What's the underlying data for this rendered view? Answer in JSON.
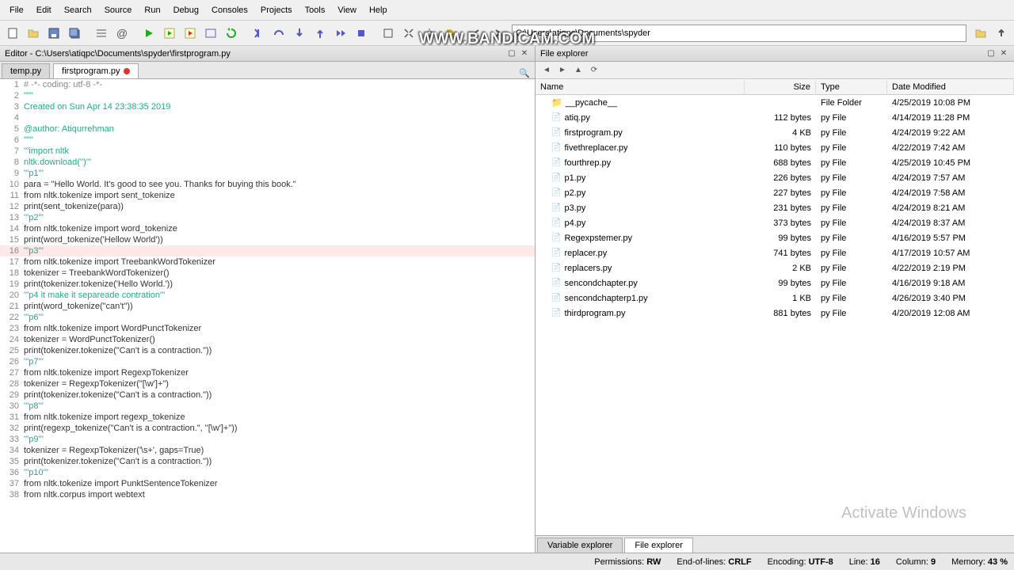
{
  "menubar": [
    "File",
    "Edit",
    "Search",
    "Source",
    "Run",
    "Debug",
    "Consoles",
    "Projects",
    "Tools",
    "View",
    "Help"
  ],
  "path": "C:\\Users\\atiqpc\\Documents\\spyder",
  "editor": {
    "title": "Editor - C:\\Users\\atiqpc\\Documents\\spyder\\firstprogram.py",
    "tabs": [
      {
        "label": "temp.py",
        "active": false,
        "dirty": false
      },
      {
        "label": "firstprogram.py",
        "active": true,
        "dirty": true
      }
    ],
    "highlight_ln": 16,
    "lines": [
      {
        "n": 1,
        "t": "# -*- coding: utf-8 -*-",
        "cls": "c-cm"
      },
      {
        "n": 2,
        "t": "\"\"\"",
        "cls": "c-str"
      },
      {
        "n": 3,
        "t": "Created on Sun Apr 14 23:38:35 2019",
        "cls": "c-str"
      },
      {
        "n": 4,
        "t": "",
        "cls": ""
      },
      {
        "n": 5,
        "t": "@author: Atiqurrehman",
        "cls": "c-str"
      },
      {
        "n": 6,
        "t": "\"\"\"",
        "cls": "c-str"
      },
      {
        "n": 7,
        "t": "'''import nltk",
        "cls": "c-str"
      },
      {
        "n": 8,
        "t": "nltk.download('')'''",
        "cls": "c-str"
      },
      {
        "n": 9,
        "t": "'''p1'''",
        "cls": "c-str"
      },
      {
        "n": 10,
        "t": "para = \"Hello World. It's good to see you. Thanks for buying this book.\"",
        "cls": ""
      },
      {
        "n": 11,
        "t": "from nltk.tokenize import sent_tokenize",
        "cls": ""
      },
      {
        "n": 12,
        "t": "print(sent_tokenize(para))",
        "cls": ""
      },
      {
        "n": 13,
        "t": "'''p2'''",
        "cls": "c-str"
      },
      {
        "n": 14,
        "t": "from nltk.tokenize import word_tokenize",
        "cls": ""
      },
      {
        "n": 15,
        "t": "print(word_tokenize('Hellow World'))",
        "cls": ""
      },
      {
        "n": 16,
        "t": "'''p3'''",
        "cls": "c-str"
      },
      {
        "n": 17,
        "t": "from nltk.tokenize import TreebankWordTokenizer",
        "cls": ""
      },
      {
        "n": 18,
        "t": "tokenizer = TreebankWordTokenizer()",
        "cls": ""
      },
      {
        "n": 19,
        "t": "print(tokenizer.tokenize('Hello World.'))",
        "cls": ""
      },
      {
        "n": 20,
        "t": "'''p4 it make it separeade contration'''",
        "cls": "c-str"
      },
      {
        "n": 21,
        "t": "print(word_tokenize(\"can't\"))",
        "cls": ""
      },
      {
        "n": 22,
        "t": "'''p6'''",
        "cls": "c-str"
      },
      {
        "n": 23,
        "t": "from nltk.tokenize import WordPunctTokenizer",
        "cls": ""
      },
      {
        "n": 24,
        "t": "tokenizer = WordPunctTokenizer()",
        "cls": ""
      },
      {
        "n": 25,
        "t": "print(tokenizer.tokenize(\"Can't is a contraction.\"))",
        "cls": ""
      },
      {
        "n": 26,
        "t": "'''p7'''",
        "cls": "c-str"
      },
      {
        "n": 27,
        "t": "from nltk.tokenize import RegexpTokenizer",
        "cls": ""
      },
      {
        "n": 28,
        "t": "tokenizer = RegexpTokenizer(\"[\\w']+\")",
        "cls": ""
      },
      {
        "n": 29,
        "t": "print(tokenizer.tokenize(\"Can't is a contraction.\"))",
        "cls": ""
      },
      {
        "n": 30,
        "t": "'''p8'''",
        "cls": "c-str"
      },
      {
        "n": 31,
        "t": "from nltk.tokenize import regexp_tokenize",
        "cls": ""
      },
      {
        "n": 32,
        "t": "print(regexp_tokenize(\"Can't is a contraction.\", \"[\\w']+\"))",
        "cls": ""
      },
      {
        "n": 33,
        "t": "'''p9'''",
        "cls": "c-str"
      },
      {
        "n": 34,
        "t": "tokenizer = RegexpTokenizer('\\s+', gaps=True)",
        "cls": ""
      },
      {
        "n": 35,
        "t": "print(tokenizer.tokenize(\"Can't is a contraction.\"))",
        "cls": ""
      },
      {
        "n": 36,
        "t": "'''p10'''",
        "cls": "c-str"
      },
      {
        "n": 37,
        "t": "from nltk.tokenize import PunktSentenceTokenizer",
        "cls": ""
      },
      {
        "n": 38,
        "t": "from nltk.corpus import webtext",
        "cls": ""
      }
    ]
  },
  "explorer": {
    "title": "File explorer",
    "cols": {
      "name": "Name",
      "size": "Size",
      "type": "Type",
      "date": "Date Modified"
    },
    "rows": [
      {
        "name": "__pycache__",
        "size": "",
        "type": "File Folder",
        "date": "4/25/2019 10:08 PM",
        "folder": true
      },
      {
        "name": "atiq.py",
        "size": "112 bytes",
        "type": "py File",
        "date": "4/14/2019 11:28 PM"
      },
      {
        "name": "firstprogram.py",
        "size": "4 KB",
        "type": "py File",
        "date": "4/24/2019 9:22 AM"
      },
      {
        "name": "fivethreplacer.py",
        "size": "110 bytes",
        "type": "py File",
        "date": "4/22/2019 7:42 AM"
      },
      {
        "name": "fourthrep.py",
        "size": "688 bytes",
        "type": "py File",
        "date": "4/25/2019 10:45 PM"
      },
      {
        "name": "p1.py",
        "size": "226 bytes",
        "type": "py File",
        "date": "4/24/2019 7:57 AM"
      },
      {
        "name": "p2.py",
        "size": "227 bytes",
        "type": "py File",
        "date": "4/24/2019 7:58 AM"
      },
      {
        "name": "p3.py",
        "size": "231 bytes",
        "type": "py File",
        "date": "4/24/2019 8:21 AM"
      },
      {
        "name": "p4.py",
        "size": "373 bytes",
        "type": "py File",
        "date": "4/24/2019 8:37 AM"
      },
      {
        "name": "Regexpstemer.py",
        "size": "99 bytes",
        "type": "py File",
        "date": "4/16/2019 5:57 PM"
      },
      {
        "name": "replacer.py",
        "size": "741 bytes",
        "type": "py File",
        "date": "4/17/2019 10:57 AM"
      },
      {
        "name": "replacers.py",
        "size": "2 KB",
        "type": "py File",
        "date": "4/22/2019 2:19 PM"
      },
      {
        "name": "sencondchapter.py",
        "size": "99 bytes",
        "type": "py File",
        "date": "4/16/2019 9:18 AM"
      },
      {
        "name": "sencondchapterp1.py",
        "size": "1 KB",
        "type": "py File",
        "date": "4/26/2019 3:40 PM"
      },
      {
        "name": "thirdprogram.py",
        "size": "881 bytes",
        "type": "py File",
        "date": "4/20/2019 12:08 AM"
      }
    ],
    "bottom_tabs": [
      {
        "label": "Variable explorer",
        "active": false
      },
      {
        "label": "File explorer",
        "active": true
      }
    ]
  },
  "status": {
    "perm_label": "Permissions:",
    "perm": "RW",
    "eol_label": "End-of-lines:",
    "eol": "CRLF",
    "enc_label": "Encoding:",
    "enc": "UTF-8",
    "line_label": "Line:",
    "line": "16",
    "col_label": "Column:",
    "col": "9",
    "mem_label": "Memory:",
    "mem": "43 %"
  },
  "watermark": "WWW.BANDICAM.COM",
  "activate": "Activate Windows"
}
